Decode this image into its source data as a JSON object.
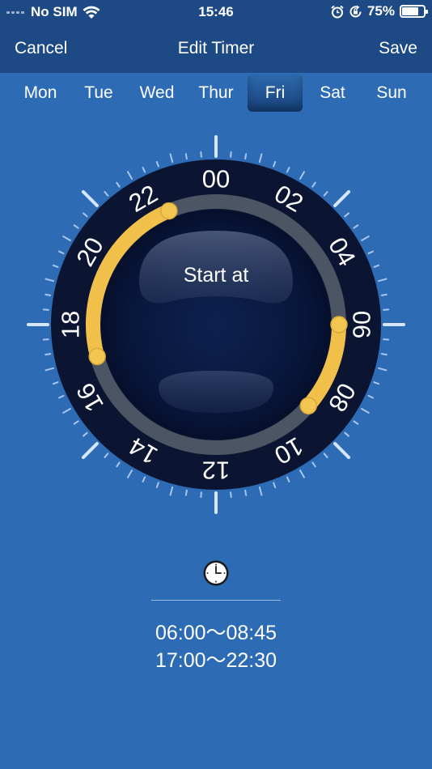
{
  "status": {
    "carrier": "No SIM",
    "time": "15:46",
    "battery_text": "75%",
    "battery_level": 0.75
  },
  "nav": {
    "cancel_label": "Cancel",
    "title": "Edit Timer",
    "save_label": "Save"
  },
  "days": [
    {
      "label": "Mon",
      "active": false
    },
    {
      "label": "Tue",
      "active": false
    },
    {
      "label": "Wed",
      "active": false
    },
    {
      "label": "Thur",
      "active": false
    },
    {
      "label": "Fri",
      "active": true
    },
    {
      "label": "Sat",
      "active": false
    },
    {
      "label": "Sun",
      "active": false
    }
  ],
  "dial": {
    "center_label": "Start at",
    "hour_labels": [
      "00",
      "02",
      "04",
      "06",
      "08",
      "10",
      "12",
      "14",
      "16",
      "18",
      "20",
      "22"
    ],
    "segments": [
      {
        "start_hour": 6.0,
        "end_hour": 8.75
      },
      {
        "start_hour": 17.0,
        "end_hour": 22.5
      }
    ],
    "colors": {
      "bezel": "#0b1430",
      "track": "#4b5563",
      "active": "#f0c04a"
    }
  },
  "schedule": {
    "ranges": [
      "06:00～08:45",
      "17:00～22:30"
    ]
  }
}
